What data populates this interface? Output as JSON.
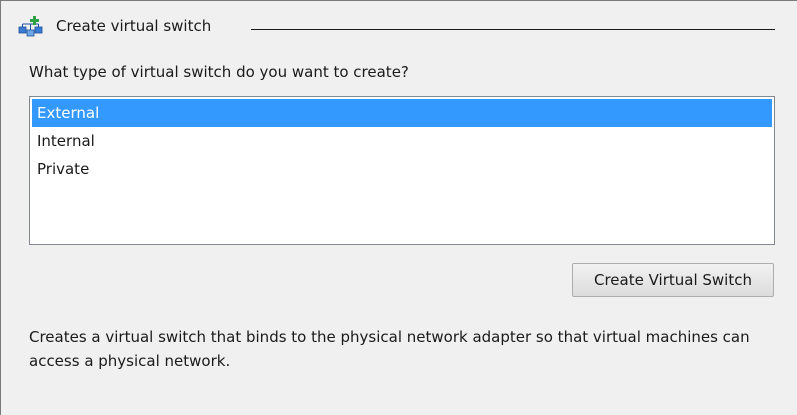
{
  "section": {
    "title": "Create virtual switch",
    "icon": "add-network-switch-icon"
  },
  "question": "What type of virtual switch do you want to create?",
  "switch_types": [
    {
      "label": "External",
      "selected": true
    },
    {
      "label": "Internal",
      "selected": false
    },
    {
      "label": "Private",
      "selected": false
    }
  ],
  "create_button_label": "Create Virtual Switch",
  "description": "Creates a virtual switch that binds to the physical network adapter so that virtual machines can access a physical network.",
  "colors": {
    "selection": "#3399ff",
    "icon_green": "#2ea043",
    "icon_blue": "#3a7bd5"
  }
}
